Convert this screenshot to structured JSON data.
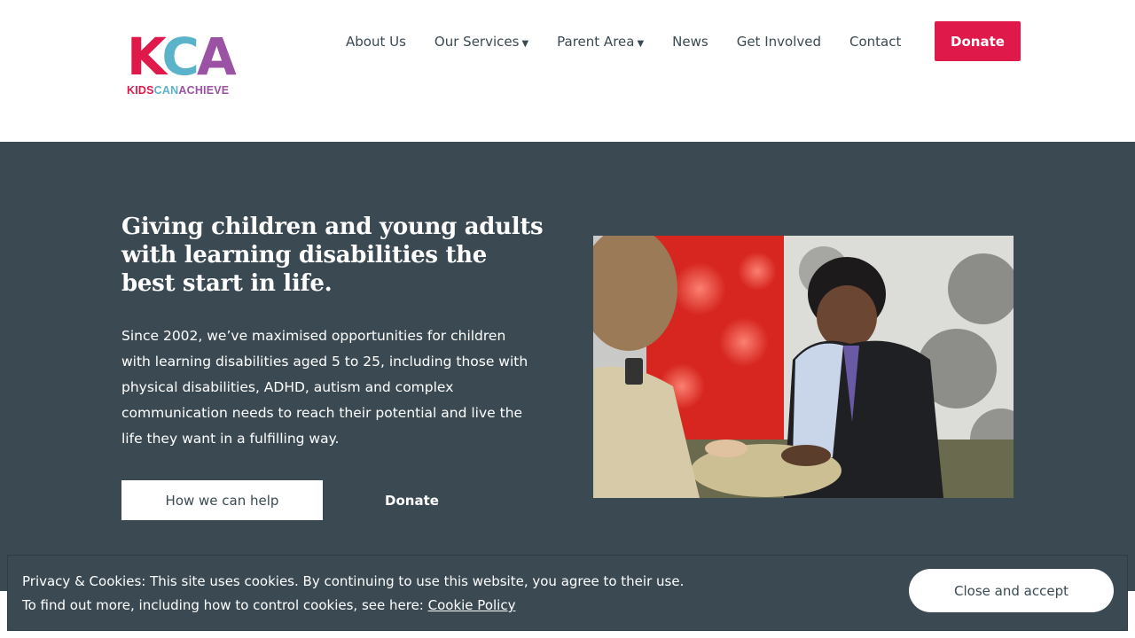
{
  "logo": {
    "mark_k": "K",
    "mark_c": "C",
    "mark_a": "A",
    "tag_kids": "KIDS",
    "tag_can": "CAN",
    "tag_achieve": "ACHIEVE"
  },
  "nav": {
    "items": [
      {
        "label": "About Us"
      },
      {
        "label": "Our Services",
        "dropdown": true
      },
      {
        "label": "Parent Area",
        "dropdown": true
      },
      {
        "label": "News"
      },
      {
        "label": "Get Involved"
      },
      {
        "label": "Contact"
      }
    ],
    "donate_label": "Donate"
  },
  "hero": {
    "title": "Giving children and young adults with learning disabilities the best start in life.",
    "body": "Since 2002, we’ve maximised opportunities for children with learning disabilities aged 5 to 25, including those with physical disabilities, ADHD, autism and complex communication needs to reach their potential and live the life they want in a fulfilling way.",
    "help_label": "How we can help",
    "donate_label": "Donate"
  },
  "cookie": {
    "line1": "Privacy & Cookies: This site uses cookies. By continuing to use this website, you agree to their use.",
    "line2_prefix": "To find out more, including how to control cookies, see here: ",
    "link_label": "Cookie Policy",
    "accept_label": "Close and accept"
  },
  "colors": {
    "brand_pink": "#e0194b",
    "brand_blue": "#5bb3c9",
    "brand_purple": "#9b52a4",
    "hero_bg": "#3b4a52"
  },
  "icons": {
    "caret": "caret-down-icon"
  }
}
